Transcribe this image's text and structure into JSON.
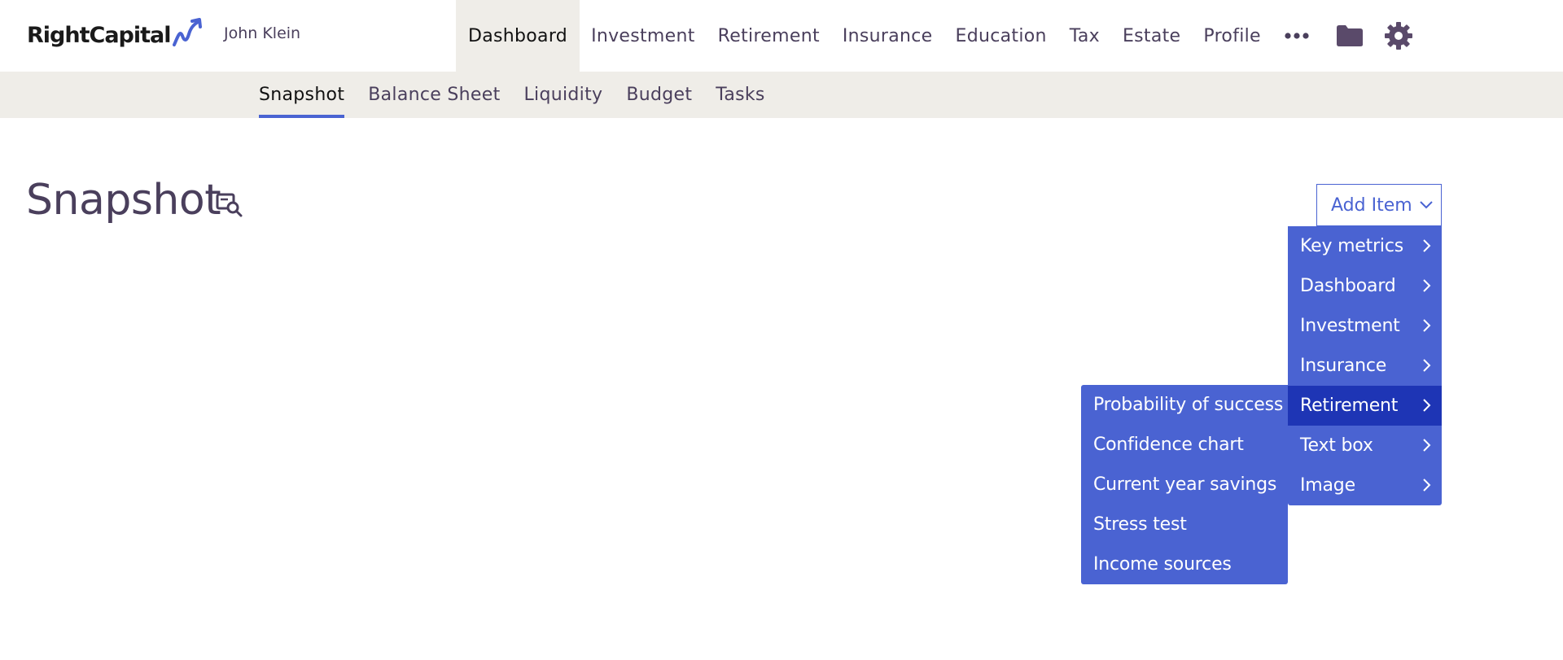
{
  "app": {
    "logo_text": "RightCapital",
    "client_name": "John Klein"
  },
  "main_nav": [
    {
      "label": "Dashboard",
      "active": true
    },
    {
      "label": "Investment"
    },
    {
      "label": "Retirement"
    },
    {
      "label": "Insurance"
    },
    {
      "label": "Education"
    },
    {
      "label": "Tax"
    },
    {
      "label": "Estate"
    },
    {
      "label": "Profile"
    }
  ],
  "nav_icons": [
    "more-icon",
    "folder-icon",
    "gear-icon"
  ],
  "sub_nav": [
    {
      "label": "Snapshot",
      "active": true
    },
    {
      "label": "Balance Sheet"
    },
    {
      "label": "Liquidity"
    },
    {
      "label": "Budget"
    },
    {
      "label": "Tasks"
    }
  ],
  "page": {
    "title": "Snapshot",
    "add_item_label": "Add Item"
  },
  "add_menu": [
    {
      "label": "Key metrics"
    },
    {
      "label": "Dashboard"
    },
    {
      "label": "Investment"
    },
    {
      "label": "Insurance"
    },
    {
      "label": "Retirement",
      "active": true
    },
    {
      "label": "Text box"
    },
    {
      "label": "Image"
    }
  ],
  "retirement_submenu": [
    {
      "label": "Probability of success"
    },
    {
      "label": "Confidence chart"
    },
    {
      "label": "Current year savings"
    },
    {
      "label": "Stress test"
    },
    {
      "label": "Income sources"
    }
  ],
  "colors": {
    "accent": "#4a63d2",
    "accent_dark": "#1e35b5",
    "nav_active_bg": "#efede8",
    "text": "#4a3f5c"
  }
}
